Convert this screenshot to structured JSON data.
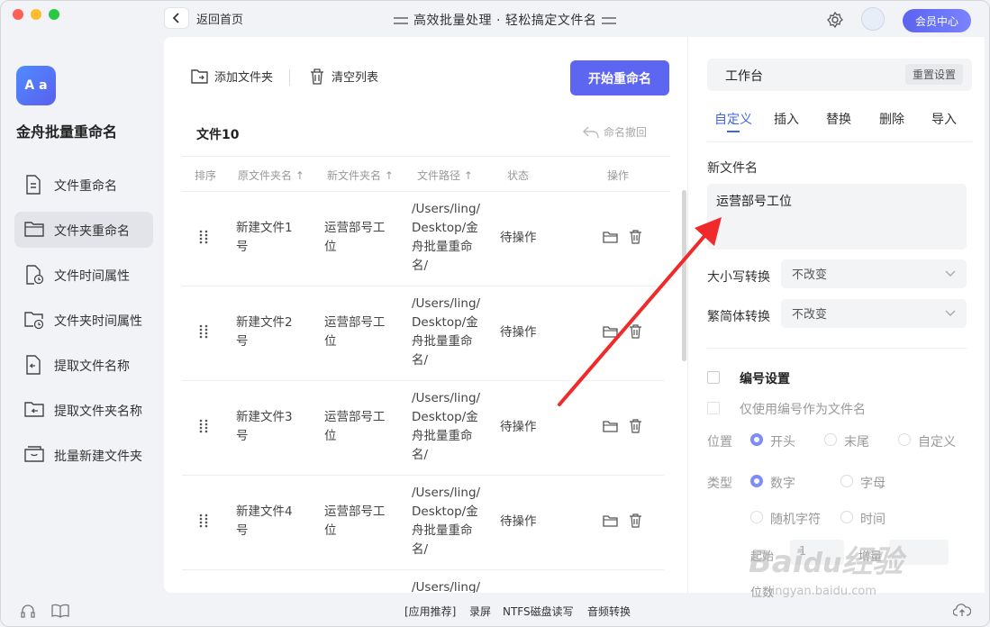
{
  "window": {
    "back_label": "返回首页",
    "title": "高效批量处理 · 轻松搞定文件名",
    "vip_label": "会员中心"
  },
  "sidebar": {
    "app_name": "金舟批量重命名",
    "items": [
      {
        "label": "文件重命名"
      },
      {
        "label": "文件夹重命名",
        "active": true
      },
      {
        "label": "文件时间属性"
      },
      {
        "label": "文件夹时间属性"
      },
      {
        "label": "提取文件名称"
      },
      {
        "label": "提取文件夹名称"
      },
      {
        "label": "批量新建文件夹"
      }
    ]
  },
  "toolbar": {
    "add_folder": "添加文件夹",
    "clear_list": "清空列表",
    "start": "开始重命名"
  },
  "list": {
    "count_label": "文件10",
    "undo_label": "命名撤回",
    "headers": [
      "排序",
      "原文件夹名",
      "新文件夹名",
      "文件路径",
      "状态",
      "操作"
    ],
    "rows": [
      {
        "orig": [
          "新建文件1",
          "号"
        ],
        "new": [
          "运营部号工",
          "位"
        ],
        "path": [
          "/Users/ling/",
          "Desktop/金",
          "舟批量重命",
          "名/"
        ],
        "status": "待操作"
      },
      {
        "orig": [
          "新建文件2",
          "号"
        ],
        "new": [
          "运营部号工",
          "位"
        ],
        "path": [
          "/Users/ling/",
          "Desktop/金",
          "舟批量重命",
          "名/"
        ],
        "status": "待操作"
      },
      {
        "orig": [
          "新建文件3",
          "号"
        ],
        "new": [
          "运营部号工",
          "位"
        ],
        "path": [
          "/Users/ling/",
          "Desktop/金",
          "舟批量重命",
          "名/"
        ],
        "status": "待操作"
      },
      {
        "orig": [
          "新建文件4",
          "号"
        ],
        "new": [
          "运营部号工",
          "位"
        ],
        "path": [
          "/Users/ling/",
          "Desktop/金",
          "舟批量重命",
          "名/"
        ],
        "status": "待操作"
      },
      {
        "orig": [
          "",
          ""
        ],
        "new": [
          "",
          ""
        ],
        "path": [
          "/Users/ling/",
          "",
          "",
          ""
        ],
        "status": ""
      }
    ]
  },
  "workbench": {
    "title": "工作台",
    "reset": "重置设置",
    "tabs": [
      "自定义",
      "插入",
      "替换",
      "删除",
      "导入"
    ],
    "new_name_label": "新文件名",
    "new_name_value": "运营部号工位",
    "case_label": "大小写转换",
    "case_value": "不改变",
    "trad_label": "繁简体转换",
    "trad_value": "不改变",
    "number_label": "编号设置",
    "only_number_label": "仅使用编号作为文件名",
    "position_label": "位置",
    "position_options": [
      "开头",
      "末尾",
      "自定义"
    ],
    "type_label": "类型",
    "type_options": [
      "数字",
      "字母",
      "随机字符",
      "时间"
    ],
    "start_label": "起始",
    "start_value": "1",
    "step_label": "增量",
    "digits_label": "位数"
  },
  "bottom": {
    "links": [
      "[应用推荐]",
      "录屏",
      "NTFS磁盘读写",
      "音频转换"
    ]
  },
  "watermark": {
    "text": "Baidu经验",
    "url": "jingyan.baidu.com"
  },
  "colors": {
    "accent": "#5d66f0",
    "tab_active": "#3f63e6",
    "arrow": "#f02a2a"
  }
}
